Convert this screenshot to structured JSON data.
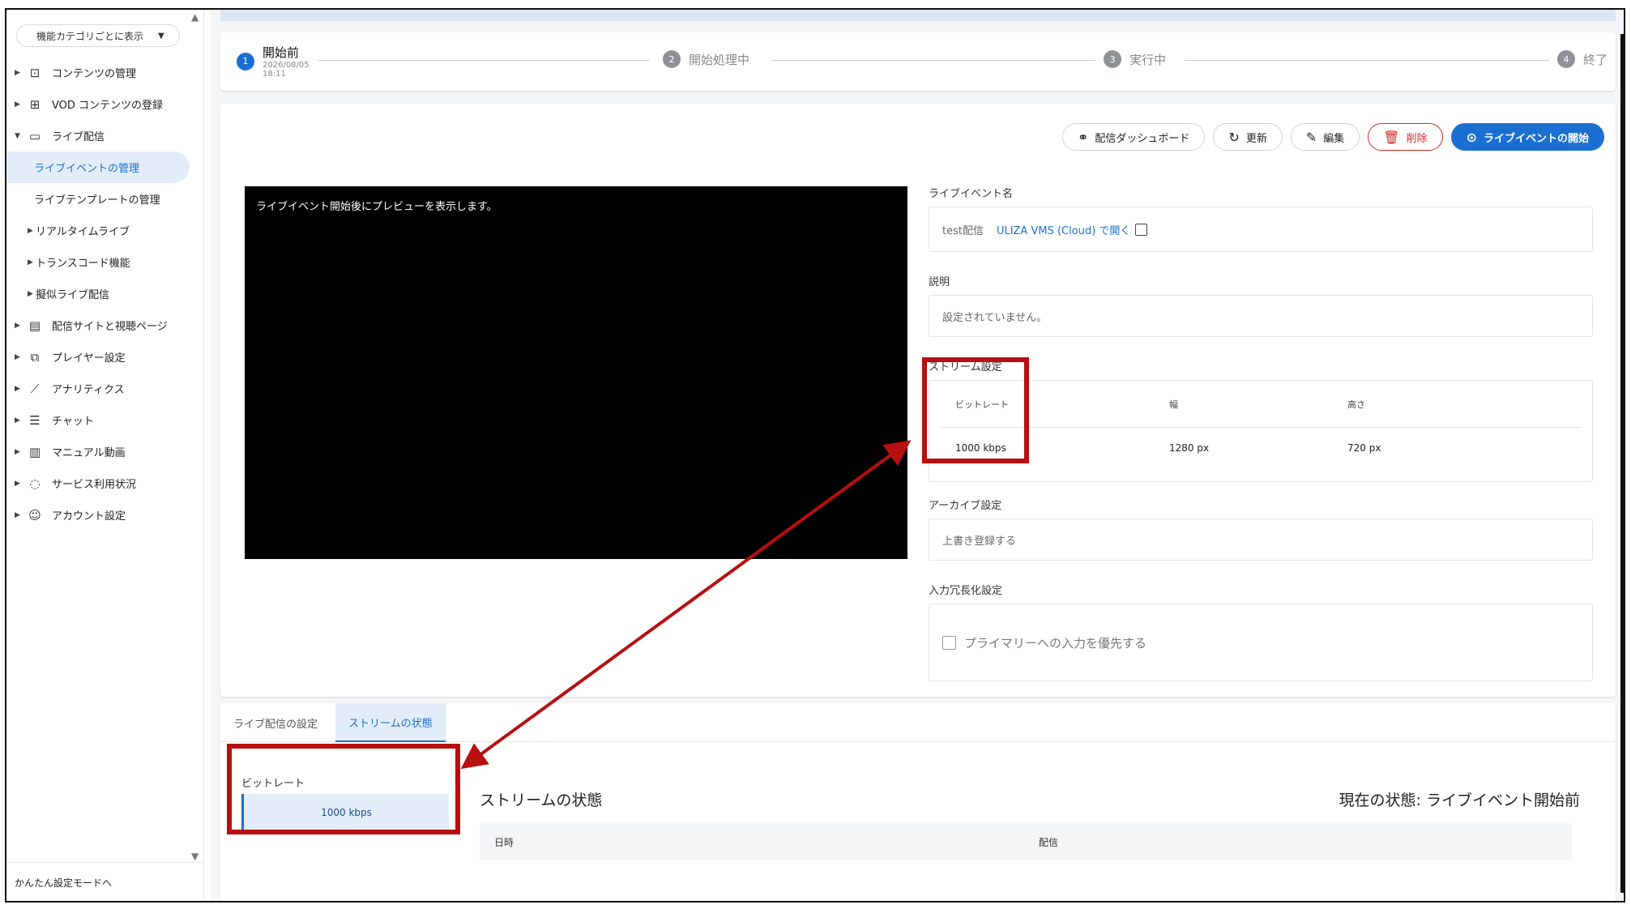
{
  "sidebar": {
    "category_select": "機能カテゴリごとに表示",
    "items": [
      {
        "label": "コンテンツの管理"
      },
      {
        "label": "VOD コンテンツの登録"
      },
      {
        "label": "ライブ配信"
      },
      {
        "label": "ライブイベントの管理"
      },
      {
        "label": "ライブテンプレートの管理"
      },
      {
        "label": "リアルタイムライブ"
      },
      {
        "label": "トランスコード機能"
      },
      {
        "label": "擬似ライブ配信"
      },
      {
        "label": "配信サイトと視聴ページ"
      },
      {
        "label": "プレイヤー設定"
      },
      {
        "label": "アナリティクス"
      },
      {
        "label": "チャット"
      },
      {
        "label": "マニュアル動画"
      },
      {
        "label": "サービス利用状況"
      },
      {
        "label": "アカウント設定"
      }
    ],
    "footer": "かんたん設定モードへ"
  },
  "steps": [
    {
      "num": "1",
      "label": "開始前",
      "date": "2026/08/05",
      "time": "18:11"
    },
    {
      "num": "2",
      "label": "開始処理中"
    },
    {
      "num": "3",
      "label": "実行中"
    },
    {
      "num": "4",
      "label": "終了"
    }
  ],
  "actions": {
    "dashboard": "配信ダッシュボード",
    "refresh": "更新",
    "edit": "編集",
    "delete": "削除",
    "start": "ライブイベントの開始"
  },
  "preview": {
    "message": "ライブイベント開始後にプレビューを表示します。"
  },
  "fields": {
    "name_label": "ライブイベント名",
    "name_value": "test配信",
    "name_link": "ULIZA VMS (Cloud) で開く",
    "desc_label": "説明",
    "desc_value": "設定されていません。",
    "stream_label": "ストリーム設定",
    "stream_headers": [
      "ビットレート",
      "幅",
      "高さ"
    ],
    "stream_values": [
      "1000 kbps",
      "1280 px",
      "720 px"
    ],
    "archive_label": "アーカイブ設定",
    "archive_value": "上書き登録する",
    "redundancy_label": "入力冗長化設定",
    "redundancy_option": "プライマリーへの入力を優先する"
  },
  "bottom": {
    "tabs": [
      "ライブ配信の設定",
      "ストリームの状態"
    ],
    "bitrate_label": "ビットレート",
    "bitrate_value": "1000 kbps",
    "title": "ストリームの状態",
    "status": "現在の状態: ライブイベント開始前",
    "table_headers": [
      "日時",
      "配信"
    ]
  },
  "colors": {
    "accent": "#1a6fd1",
    "danger": "#d12a2a",
    "annotation": "#b80f0f"
  }
}
